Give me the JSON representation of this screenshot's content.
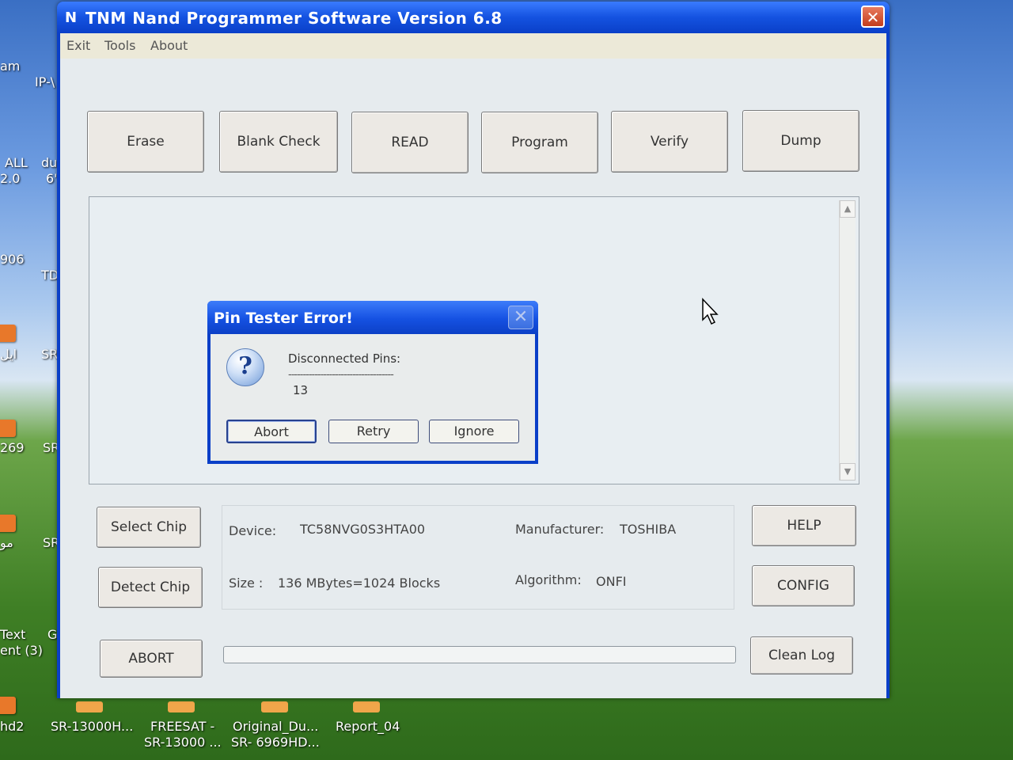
{
  "desktop": {
    "left_labels": [
      "am",
      "IP-\\",
      "ALL",
      "2.0",
      "du",
      "6'",
      "906",
      "TD",
      "ايل",
      "SR",
      "269",
      "SR",
      "مو",
      "SR_",
      "Text",
      "ent (3)",
      "GXI",
      "hd2"
    ],
    "bottom_icons": [
      {
        "line1": "SR-13000H...",
        "line2": ""
      },
      {
        "line1": "FREESAT -",
        "line2": "SR-13000 ..."
      },
      {
        "line1": "Original_Du...",
        "line2": "SR- 6969HD..."
      },
      {
        "line1": "Report_04",
        "line2": ""
      }
    ]
  },
  "window": {
    "title": "TNM  Nand Programmer Software     Version 6.8",
    "close_glyph": "✕",
    "menu": [
      "Exit",
      "Tools",
      "About"
    ]
  },
  "toolbar": [
    "Erase",
    "Blank  Check",
    "READ",
    "Program",
    "Verify",
    "Dump"
  ],
  "side_buttons": {
    "select_chip": "Select Chip",
    "detect_chip": "Detect Chip",
    "abort": "ABORT",
    "help": "HELP",
    "config": "CONFIG",
    "clean_log": "Clean Log"
  },
  "info": {
    "device_label": "Device:",
    "device_value": "TC58NVG0S3HTA00",
    "manufacturer_label": "Manufacturer:",
    "manufacturer_value": "TOSHIBA",
    "size_label": "Size :",
    "size_value": "136 MBytes=1024 Blocks",
    "algorithm_label": "Algorithm:",
    "algorithm_value": "ONFI"
  },
  "progress": {
    "value": 0
  },
  "dialog": {
    "title": "Pin Tester Error!",
    "close_glyph": "✕",
    "icon": "question-icon",
    "message": "Disconnected Pins:",
    "separator": "------------------------------------",
    "pin": "13",
    "buttons": {
      "abort": "Abort",
      "retry": "Retry",
      "ignore": "Ignore"
    }
  }
}
